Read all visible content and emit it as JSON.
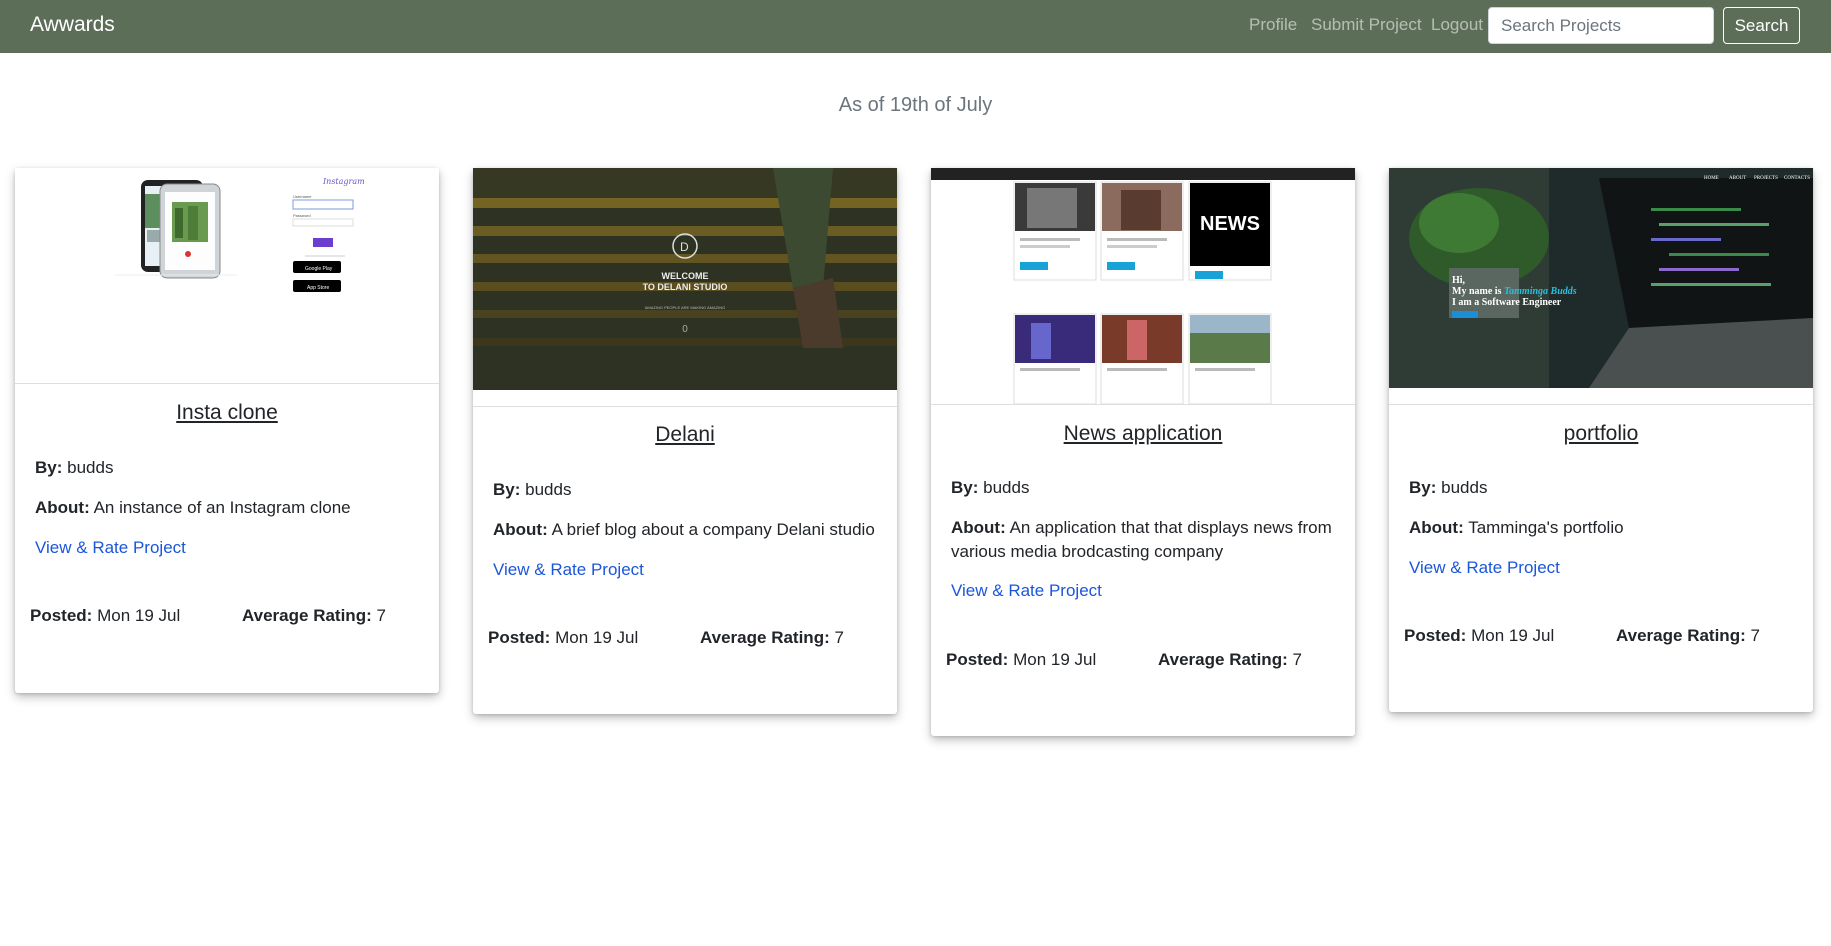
{
  "nav": {
    "brand": "Awwards",
    "links": [
      "Profile",
      "Submit Project",
      "Logout"
    ],
    "search_placeholder": "Search Projects",
    "search_button": "Search"
  },
  "subtitle": "As of 19th of July",
  "labels": {
    "by": "By:",
    "about": "About:",
    "posted": "Posted:",
    "rating": "Average Rating:"
  },
  "projects": [
    {
      "title": "Insta clone",
      "author": "budds",
      "about": "An instance of an Instagram clone",
      "link": "View & Rate Project",
      "posted": "Mon 19 Jul",
      "rating": "7"
    },
    {
      "title": "Delani",
      "author": "budds",
      "about": "A brief blog about a company Delani studio",
      "link": "View & Rate Project",
      "posted": "Mon 19 Jul",
      "rating": "7"
    },
    {
      "title": "News application",
      "author": "budds",
      "about": "An application that that displays news from various media brodcasting company",
      "link": "View & Rate Project",
      "posted": "Mon 19 Jul",
      "rating": "7"
    },
    {
      "title": "portfolio",
      "author": "budds",
      "about": "Tamminga's portfolio",
      "link": "View & Rate Project",
      "posted": "Mon 19 Jul",
      "rating": "7"
    }
  ],
  "thumbnails": {
    "insta": {
      "logo": "Instagram",
      "field1": "Username",
      "field2": "Password",
      "badge1": "Google Play",
      "badge2": "App Store"
    },
    "delani": {
      "logo_letter": "D",
      "line1": "WELCOME",
      "line2": "TO DELANI STUDIO",
      "tagline": "AMAZING PEOPLE ARE MAKING AMAZING",
      "arrow": "0"
    },
    "news": {
      "logo": "NEWS",
      "button": "READ MORE"
    },
    "portfolio": {
      "line1": "Hi,",
      "line2_prefix": "My name is ",
      "name": "Tamminga Budds",
      "line3": "I am a Software Engineer",
      "nav": [
        "HOME",
        "ABOUT",
        "PROJECTS",
        "CONTACTS"
      ]
    }
  },
  "colors": {
    "navbar": "#5c6e58",
    "link": "#1a56db",
    "subtitle": "#6c757d"
  }
}
